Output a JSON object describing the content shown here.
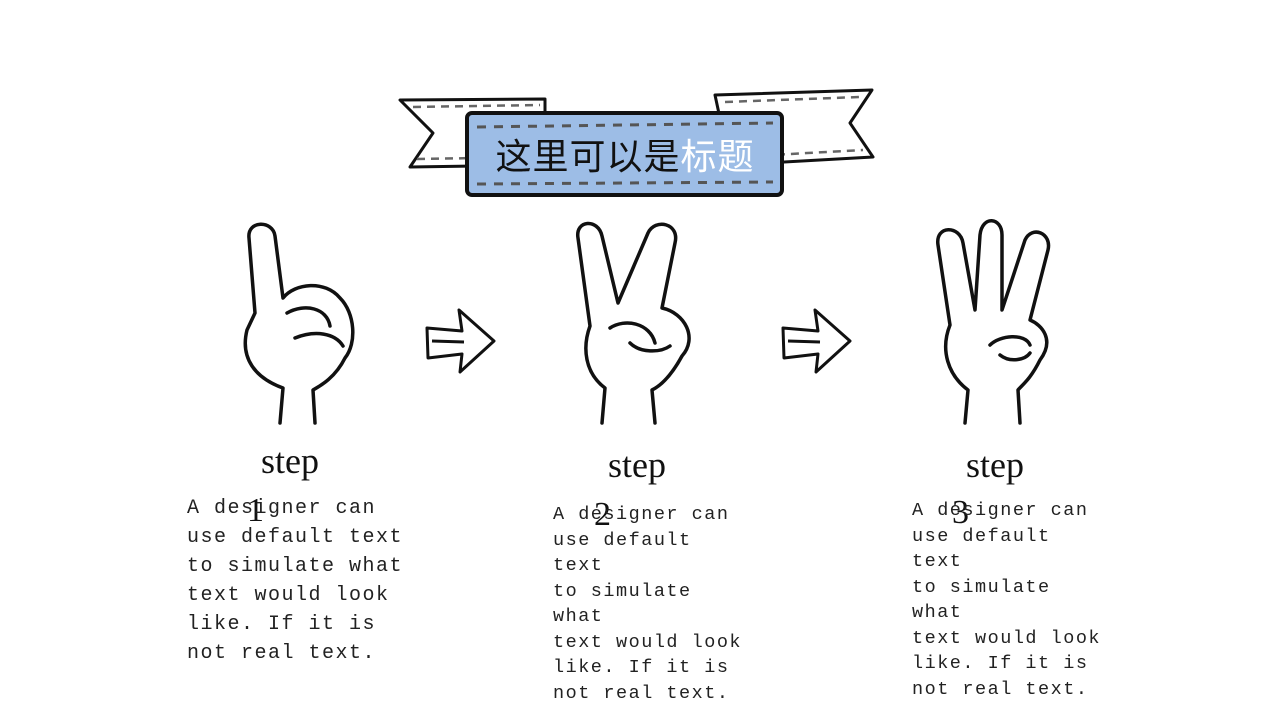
{
  "title": {
    "dark": "这里可以是",
    "highlight": "标题",
    "banner_color": "#9dbde6",
    "highlight_color": "#ffffff"
  },
  "steps": [
    {
      "label": "step",
      "number": "1",
      "body": "A designer can\nuse default text\nto simulate what\ntext would look\nlike. If it is\nnot real text.",
      "icon": "one-finger-hand-icon"
    },
    {
      "label": "step",
      "number": "2",
      "body": "A designer can\nuse default text\nto simulate what\ntext would look\nlike. If it is\nnot real text.",
      "icon": "two-finger-hand-icon"
    },
    {
      "label": "step",
      "number": "3",
      "body": "A designer can\nuse default text\nto simulate what\ntext would look\nlike. If it is\nnot real text.",
      "icon": "three-finger-hand-icon"
    }
  ],
  "arrows": [
    "arrow-right-icon",
    "arrow-right-icon"
  ]
}
